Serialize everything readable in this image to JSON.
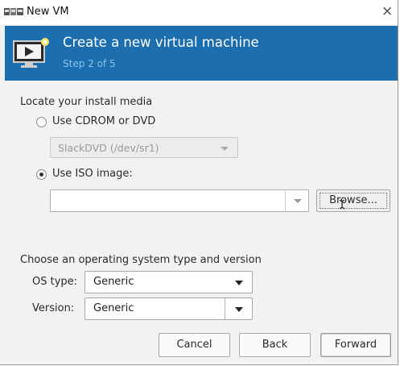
{
  "window": {
    "title": "New VM",
    "close_glyph": "×",
    "icon": "vm-manager-icon"
  },
  "banner": {
    "title": "Create a new virtual machine",
    "step": "Step 2 of 5",
    "icon": "monitor-play-icon",
    "color": "#1c6eae",
    "step_color": "#8ac2ec"
  },
  "install_media": {
    "heading": "Locate your install media",
    "cdrom_label": "Use CDROM or DVD",
    "cdrom_device": "SlackDVD (/dev/sr1)",
    "iso_label": "Use ISO image:",
    "iso_path": "",
    "browse_label": "Browse...",
    "selected": "iso"
  },
  "os": {
    "heading": "Choose an operating system type and version",
    "type_label": "OS type:",
    "type_value": "Generic",
    "version_label": "Version:",
    "version_value": "Generic"
  },
  "buttons": {
    "cancel": "Cancel",
    "back": "Back",
    "forward": "Forward"
  }
}
